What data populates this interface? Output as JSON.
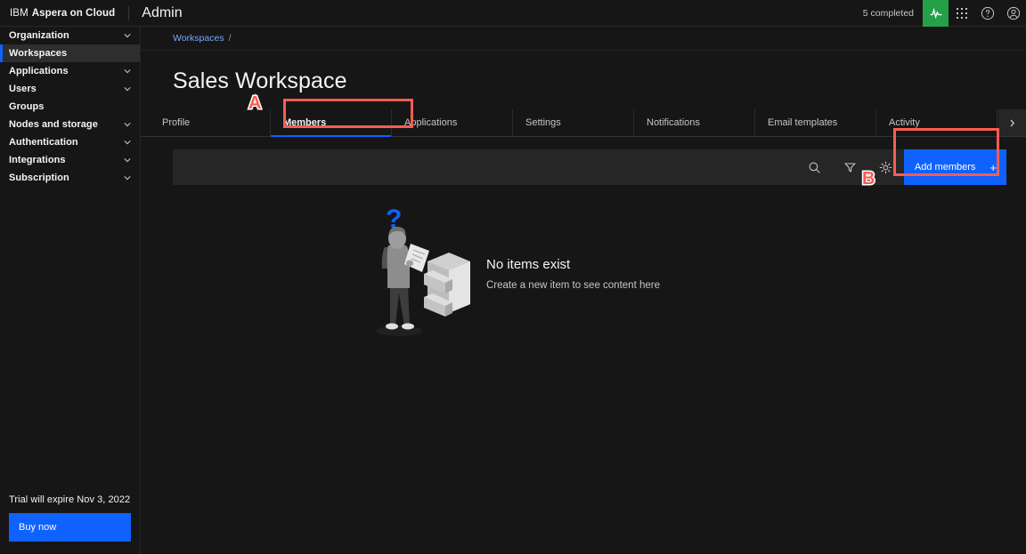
{
  "header": {
    "brand_ibm": "IBM",
    "brand_product": "Aspera on Cloud",
    "admin_label": "Admin",
    "completed_text": "5 completed",
    "activity_icon": "activity-pulse-icon",
    "apps_icon": "app-switcher-grid-icon",
    "help_icon": "help-circle-icon",
    "account_icon": "user-account-icon"
  },
  "sidebar": {
    "items": [
      {
        "label": "Organization",
        "expandable": true,
        "active": false
      },
      {
        "label": "Workspaces",
        "expandable": false,
        "active": true
      },
      {
        "label": "Applications",
        "expandable": true,
        "active": false
      },
      {
        "label": "Users",
        "expandable": true,
        "active": false
      },
      {
        "label": "Groups",
        "expandable": false,
        "active": false
      },
      {
        "label": "Nodes and storage",
        "expandable": true,
        "active": false
      },
      {
        "label": "Authentication",
        "expandable": true,
        "active": false
      },
      {
        "label": "Integrations",
        "expandable": true,
        "active": false
      },
      {
        "label": "Subscription",
        "expandable": true,
        "active": false
      }
    ],
    "trial_text": "Trial will expire Nov 3, 2022",
    "buy_label": "Buy now"
  },
  "breadcrumb": {
    "link": "Workspaces",
    "separator": "/"
  },
  "page": {
    "title": "Sales Workspace"
  },
  "tabs": {
    "items": [
      {
        "label": "Profile",
        "active": false
      },
      {
        "label": "Members",
        "active": true
      },
      {
        "label": "Applications",
        "active": false
      },
      {
        "label": "Settings",
        "active": false
      },
      {
        "label": "Notifications",
        "active": false
      },
      {
        "label": "Email templates",
        "active": false
      },
      {
        "label": "Activity",
        "active": false
      }
    ],
    "scroll_next_icon": "chevron-right-icon"
  },
  "toolbar": {
    "search_icon": "search-icon",
    "filter_icon": "filter-funnel-icon",
    "settings_icon": "gear-icon",
    "add_members_label": "Add members",
    "add_members_plus": "+"
  },
  "empty_state": {
    "illustration": "person-with-clipboard-and-filing-cabinet-illustration",
    "question_mark": "question-mark-icon",
    "title": "No items exist",
    "subtitle": "Create a new item to see content here"
  },
  "annotations": [
    {
      "letter": "A",
      "target": "members-tab"
    },
    {
      "letter": "B",
      "target": "add-members-button"
    }
  ],
  "colors": {
    "background": "#161616",
    "surface": "#262626",
    "accent_blue": "#0f62fe",
    "link_blue": "#78a9ff",
    "success_green": "#24a148",
    "annotation_red": "#ff5b52"
  }
}
